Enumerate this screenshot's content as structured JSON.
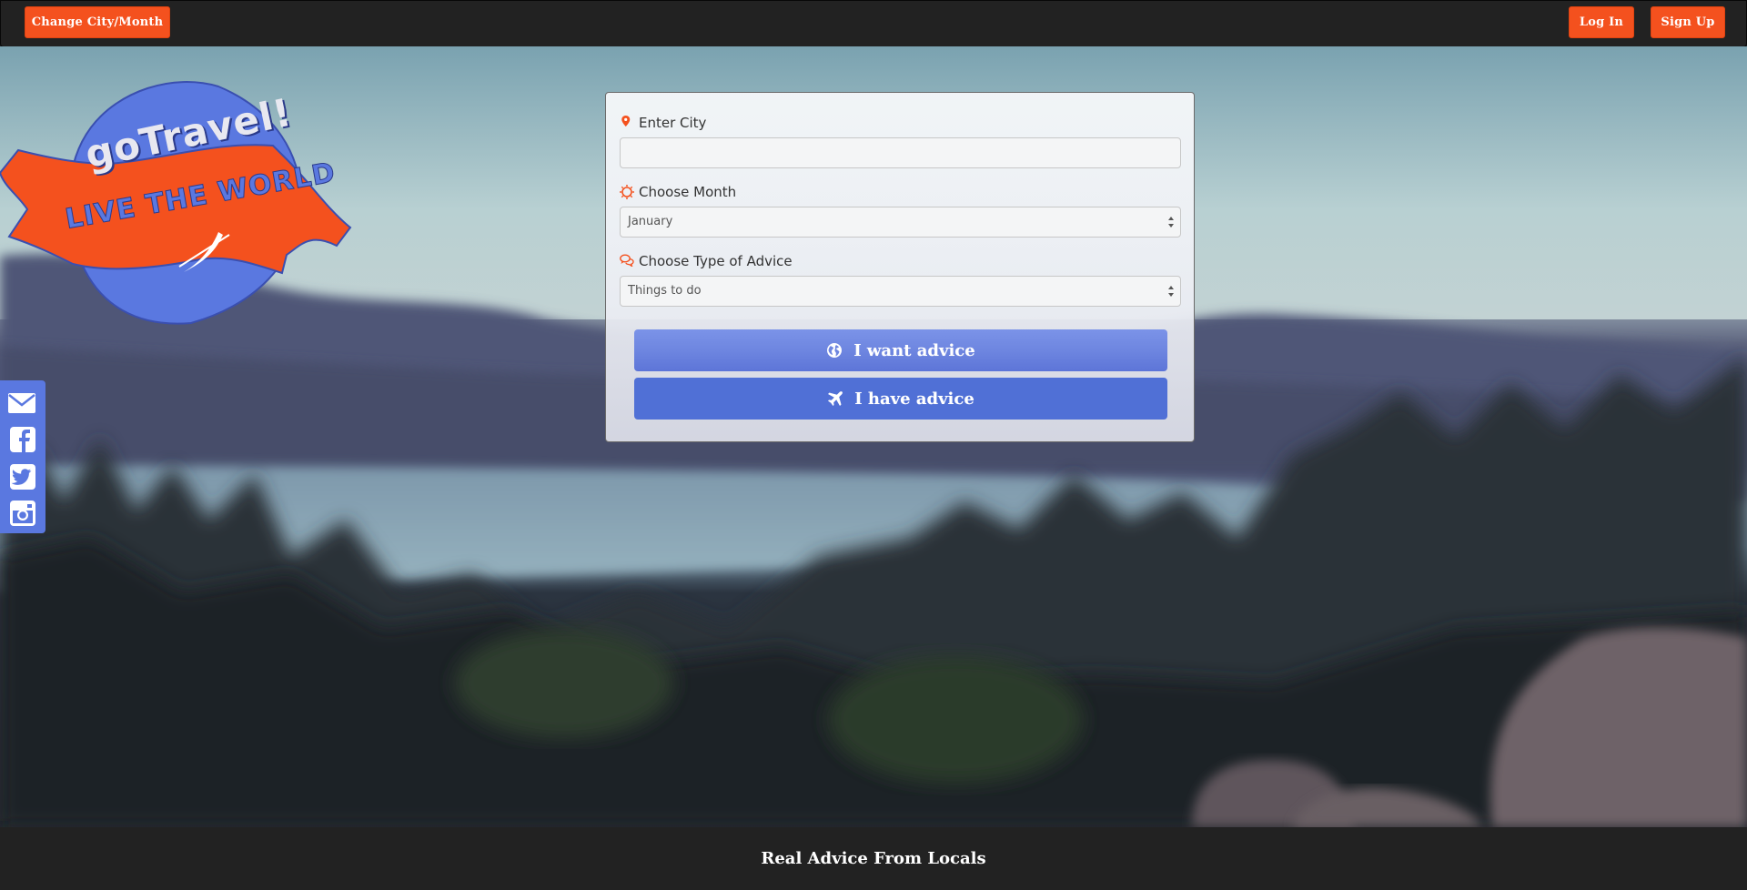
{
  "navbar": {
    "change_city_label": "Change City/Month",
    "login_label": "Log In",
    "signup_label": "Sign Up"
  },
  "logo": {
    "line1": "goTravel!",
    "line2": "LIVE THE WORLD"
  },
  "social": {
    "items": [
      "envelope-icon",
      "facebook-icon",
      "twitter-icon",
      "instagram-icon"
    ]
  },
  "form": {
    "city_label": "Enter City",
    "city_value": "",
    "month_label": "Choose Month",
    "month_selected": "January",
    "advice_type_label": "Choose Type of Advice",
    "advice_type_selected": "Things to do",
    "want_advice_label": "I want advice",
    "have_advice_label": "I have advice"
  },
  "footer": {
    "tagline": "Real Advice From Locals"
  },
  "colors": {
    "accent_orange": "#f4511e",
    "accent_blue": "#5a78e0",
    "nav_dark": "#222222"
  }
}
